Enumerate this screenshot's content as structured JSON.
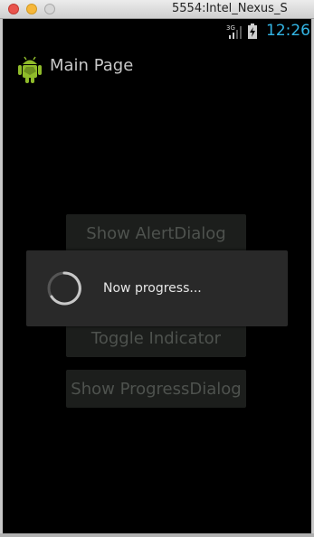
{
  "window": {
    "title": "5554:Intel_Nexus_S"
  },
  "status_bar": {
    "network": "3G",
    "time": "12:26",
    "accent": "#33b5e5"
  },
  "action_bar": {
    "title": "Main Page",
    "icon": "android-icon"
  },
  "buttons": [
    {
      "label": "Show AlertDialog"
    },
    {
      "label": "Toggle Indicator"
    },
    {
      "label": "Show ProgressDialog"
    }
  ],
  "progress_dialog": {
    "message": "Now progress...",
    "icon": "spinner-icon"
  }
}
